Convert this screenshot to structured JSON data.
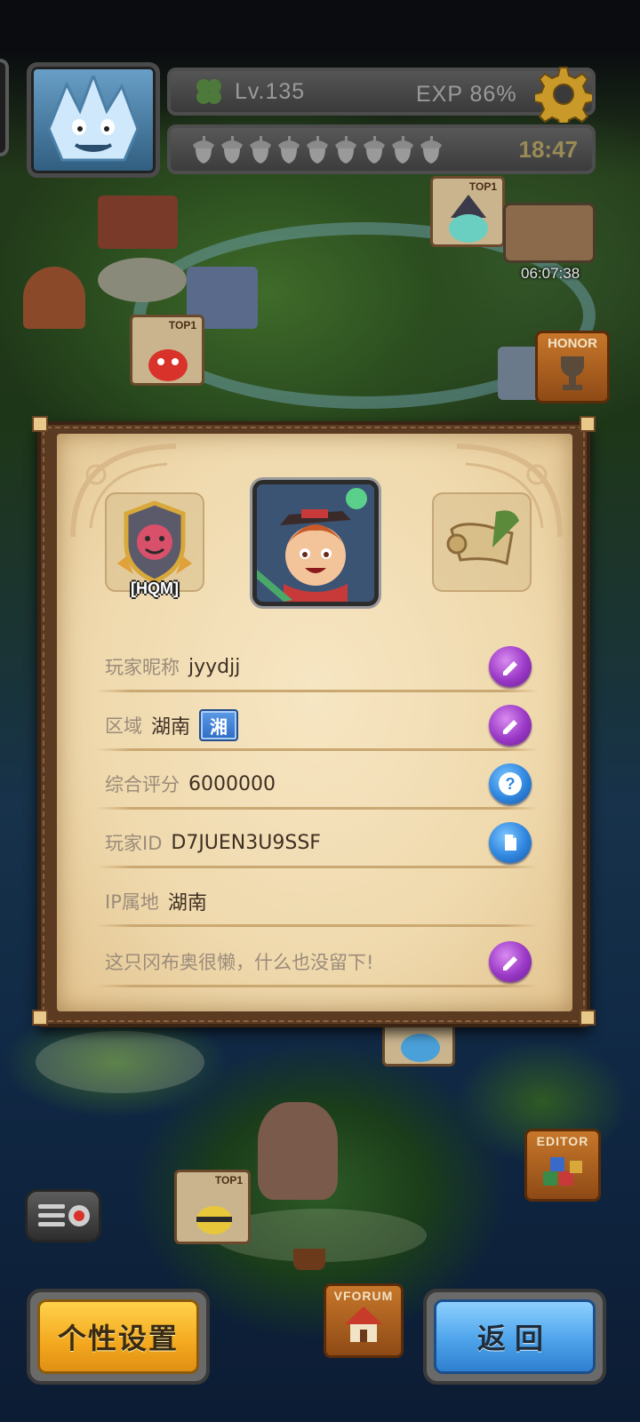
{
  "status": {
    "level": "Lv.135",
    "exp": "EXP 86%",
    "energy_count": 9,
    "energy_timer": "18:47"
  },
  "map": {
    "chest_timer": "06:07:38",
    "honor_label": "HONOR",
    "editor_label": "EDITOR",
    "vforum_label": "VFORUM",
    "top_card_label": "TOP1"
  },
  "profile": {
    "guild_tag": "[HQM]",
    "rows": [
      {
        "label": "玩家昵称",
        "value": "jyydjj",
        "action": "edit"
      },
      {
        "label": "区域",
        "value": "湖南",
        "badge": "湘",
        "action": "edit"
      },
      {
        "label": "综合评分",
        "value": "6000000",
        "action": "help"
      },
      {
        "label": "玩家ID",
        "value": "D7JUEN3U9SSF",
        "action": "copy"
      },
      {
        "label": "IP属地",
        "value": "湖南"
      },
      {
        "label": "",
        "value": "这只冈布奥很懒，什么也没留下!",
        "action": "edit"
      }
    ]
  },
  "buttons": {
    "personalize": "个性设置",
    "back": "返回"
  },
  "colors": {
    "parchment": "#efd9ad",
    "frame": "#5b3a22",
    "edit_seal": "#9a38c6",
    "info_seal": "#2f86de",
    "personal_button": "#f3a81f",
    "back_button": "#4da3ea"
  }
}
